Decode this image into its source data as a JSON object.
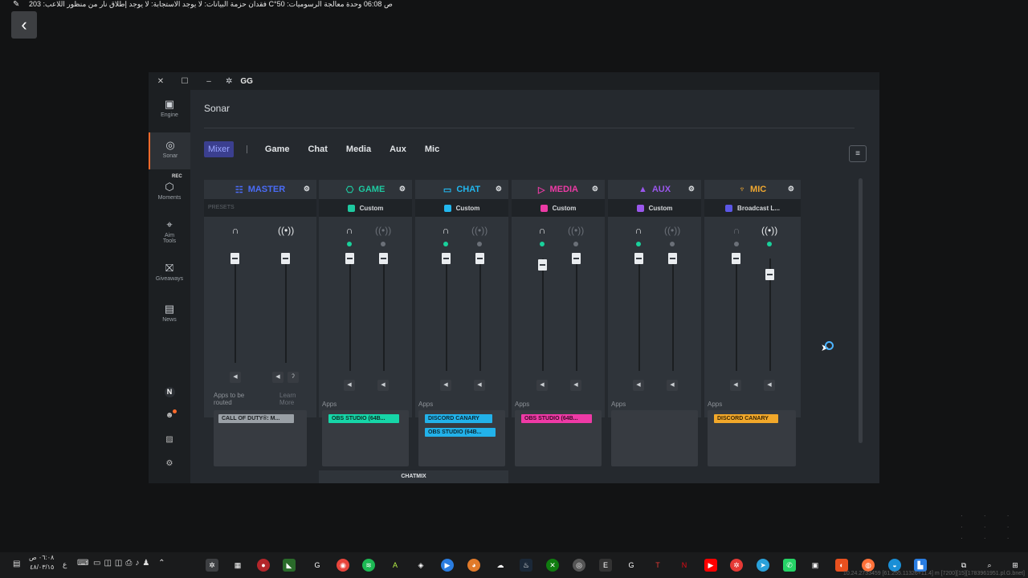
{
  "overlay": {
    "text": "ص 06:08   وحدة معالجة الرسوميات: 50°C   فقدان حزمة البيانات: لا يوجد   الاستجابة: لا يوجد   إطلاق نار من منظور اللاعب: 203"
  },
  "window": {
    "title": "GG",
    "close": "✕",
    "maximize": "☐",
    "minimize": "–"
  },
  "sidebar": {
    "items": [
      {
        "label": "Engine",
        "icon": "engine-icon"
      },
      {
        "label": "Sonar",
        "icon": "sonar-icon"
      },
      {
        "label": "Moments",
        "icon": "moments-icon",
        "badge": "REC"
      },
      {
        "label": "Aim Tools",
        "icon": "aim-icon"
      },
      {
        "label": "Giveaways",
        "icon": "gift-icon"
      },
      {
        "label": "News",
        "icon": "news-icon"
      }
    ],
    "user_initial": "N"
  },
  "main": {
    "title": "Sonar",
    "tabs": [
      "Mixer",
      "Game",
      "Chat",
      "Media",
      "Aux",
      "Mic"
    ],
    "active_tab": "Mixer"
  },
  "channels": [
    {
      "name": "MASTER",
      "color": "#4a6cf7",
      "presets_label": "PRESETS",
      "apps_label": "Apps to be routed",
      "learn_more": "Learn More",
      "apps": [
        {
          "label": "CALL OF DUTY®: M...",
          "color": "#9aa0a6"
        }
      ]
    },
    {
      "name": "GAME",
      "color": "#1ec9a0",
      "preset": "Custom",
      "apps_label": "Apps",
      "apps": [
        {
          "label": "OBS STUDIO (64B...",
          "color": "#16d6a8"
        }
      ]
    },
    {
      "name": "CHAT",
      "color": "#22b7ee",
      "preset": "Custom",
      "apps_label": "Apps",
      "apps": [
        {
          "label": "DISCORD CANARY",
          "color": "#22b2ea"
        },
        {
          "label": "OBS STUDIO (64B...",
          "color": "#22b2ea"
        }
      ]
    },
    {
      "name": "MEDIA",
      "color": "#ec3ba5",
      "preset": "Custom",
      "apps_label": "Apps",
      "apps": [
        {
          "label": "OBS STUDIO (64B...",
          "color": "#ef3aa6"
        }
      ]
    },
    {
      "name": "AUX",
      "color": "#9a57ec",
      "preset": "Custom",
      "apps_label": "Apps",
      "apps": []
    },
    {
      "name": "MIC",
      "color": "#f0a830",
      "preset": "Broadcast L...",
      "apps_label": "Apps",
      "apps": [
        {
          "label": "DISCORD CANARY",
          "color": "#f2a82a"
        }
      ]
    }
  ],
  "chatmix_label": "CHATMIX",
  "taskbar": {
    "time": "٠٦:٠٨ ص",
    "date": "٤٨/٠٣/١٥",
    "lang": "ع"
  },
  "status_text": "10.24.2733459 [61.255.11326+11.4] m [7200][15][1783961951.pl.G.bnet]"
}
